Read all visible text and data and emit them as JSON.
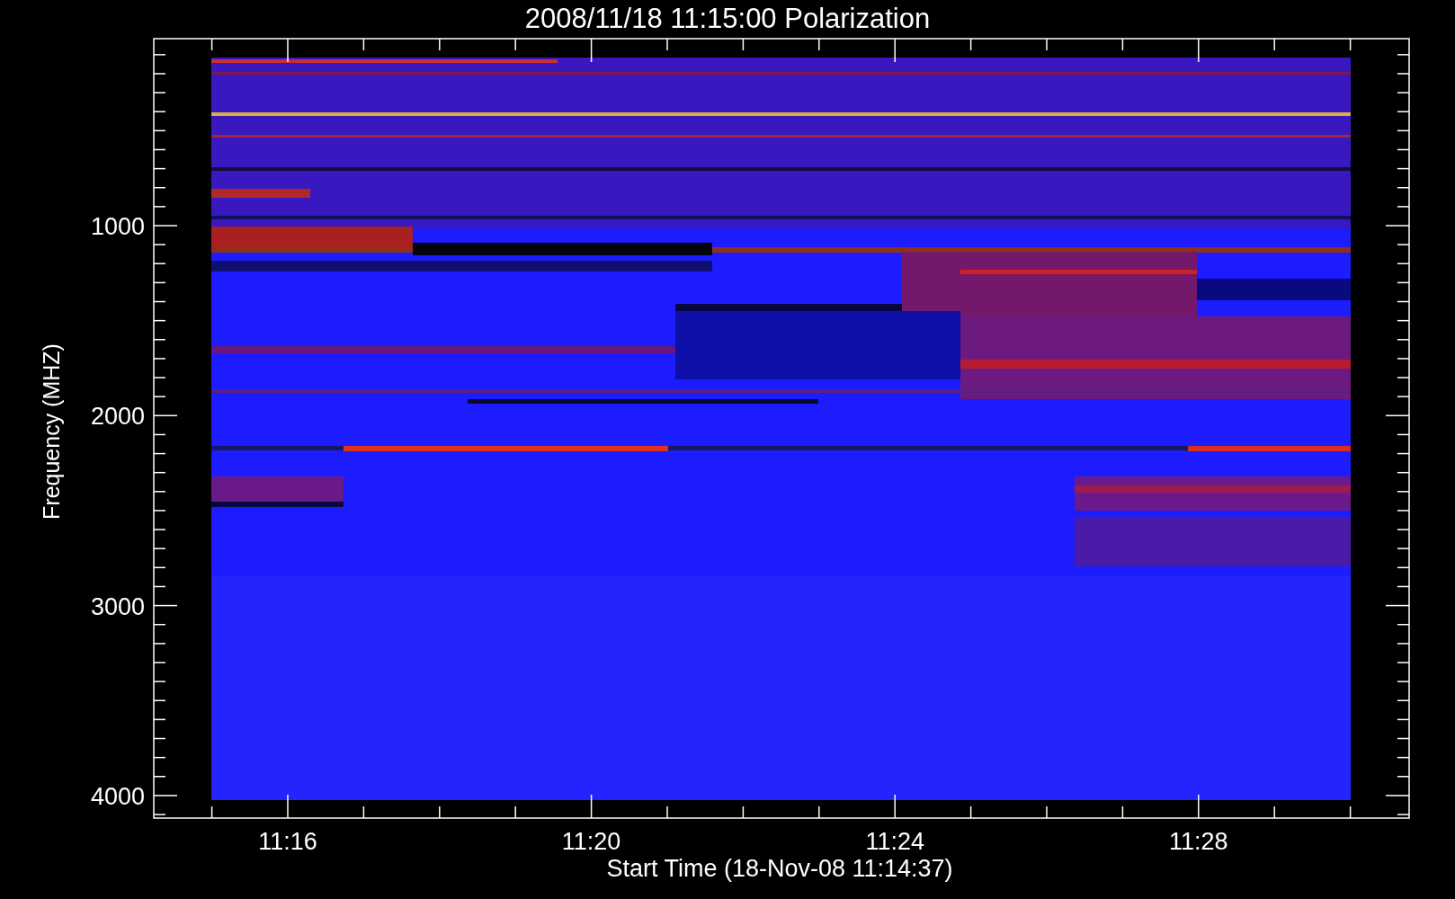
{
  "plot": {
    "title": "2008/11/18 11:15:00 Polarization",
    "ylabel": "Frequency (MHZ)",
    "xlabel": "Start Time (18-Nov-08 11:14:37)",
    "yticks": [
      "1000",
      "2000",
      "3000",
      "4000"
    ],
    "xticks": [
      "11:16",
      "11:20",
      "11:24",
      "11:28"
    ]
  }
}
